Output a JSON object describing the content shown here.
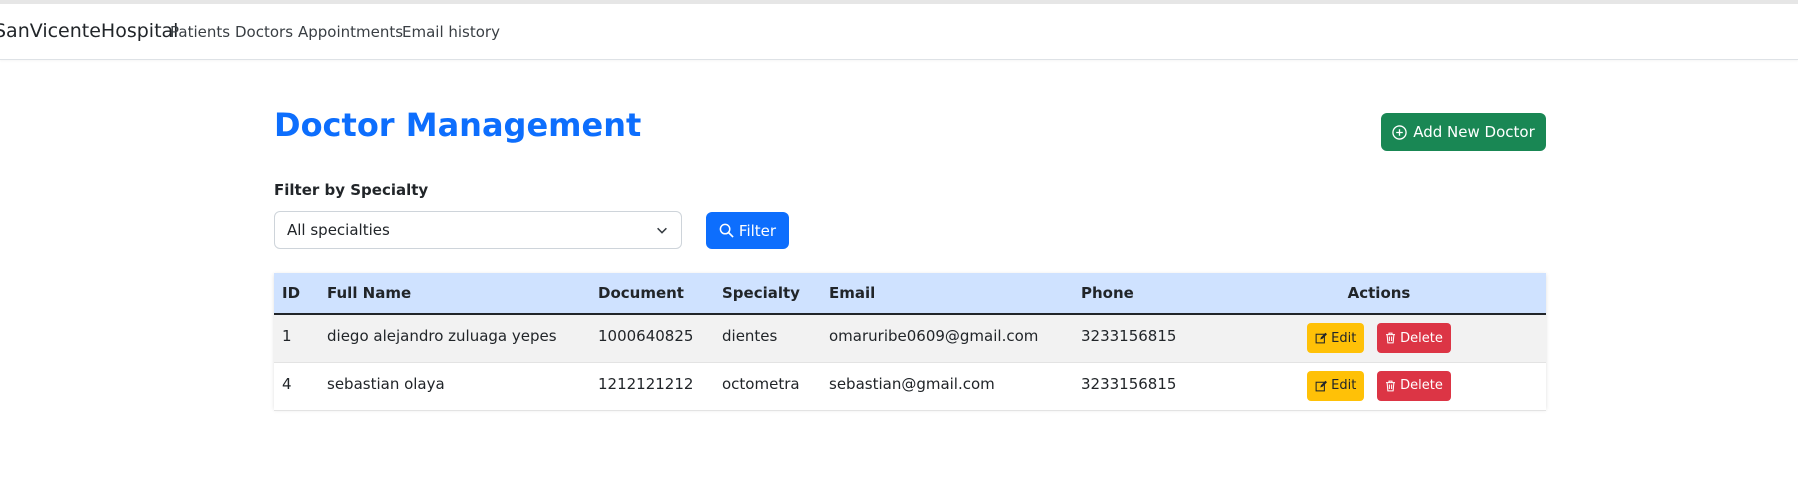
{
  "navbar": {
    "brand": "SanVicenteHospital",
    "links": [
      "Patients",
      "Doctors",
      "Appointments",
      "Email history"
    ]
  },
  "page": {
    "title": "Doctor Management",
    "add_button_label": "Add New Doctor",
    "add_icon": "plus-circle-icon"
  },
  "filter": {
    "label": "Filter by Specialty",
    "selected": "All specialties",
    "button_label": "Filter",
    "button_icon": "search-icon"
  },
  "table": {
    "headers": [
      "ID",
      "Full Name",
      "Document",
      "Specialty",
      "Email",
      "Phone",
      "Actions"
    ],
    "rows": [
      {
        "id": "1",
        "full_name": "diego alejandro zuluaga yepes",
        "document": "1000640825",
        "specialty": "dientes",
        "email": "omaruribe0609@gmail.com",
        "phone": "3233156815"
      },
      {
        "id": "4",
        "full_name": "sebastian olaya",
        "document": "1212121212",
        "specialty": "octometra",
        "email": "sebastian@gmail.com",
        "phone": "3233156815"
      }
    ],
    "edit_label": "Edit",
    "delete_label": "Delete"
  },
  "colors": {
    "primary": "#0d6efd",
    "success": "#198754",
    "warning": "#ffc107",
    "danger": "#dc3545",
    "table_header_bg": "#cfe2ff"
  }
}
